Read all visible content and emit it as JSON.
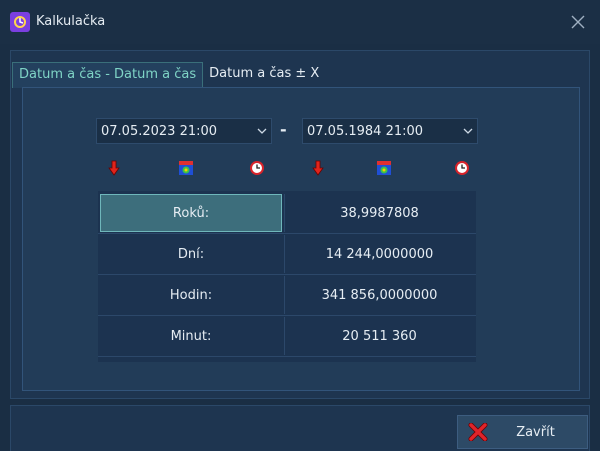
{
  "window": {
    "title": "Kalkulačka"
  },
  "tabs": [
    {
      "label": "Datum a čas - Datum a čas",
      "active": true
    },
    {
      "label": "Datum a čas ± X",
      "active": false
    }
  ],
  "date_from": {
    "value": "07.05.2023 21:00"
  },
  "operator": "-",
  "date_to": {
    "value": "07.05.1984 21:00"
  },
  "icons": [
    "down-arrow-icon",
    "calendar-icon",
    "clock-icon",
    "down-arrow-icon",
    "calendar-icon",
    "clock-icon"
  ],
  "results": [
    {
      "label": "Roků:",
      "value": "38,9987808",
      "selected": true
    },
    {
      "label": "Dní:",
      "value": "14 244,0000000"
    },
    {
      "label": "Hodin:",
      "value": "341 856,0000000"
    },
    {
      "label": "Minut:",
      "value": "20 511 360"
    }
  ],
  "footer": {
    "close_label": "Zavřít"
  },
  "colors": {
    "accent": "#7fd4c6",
    "background": "#1a2e44",
    "selected_cell": "#3d6e7c"
  }
}
